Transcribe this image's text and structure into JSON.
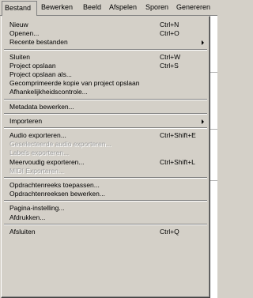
{
  "menubar": {
    "items": [
      "Bestand",
      "Bewerken",
      "Beeld",
      "Afspelen",
      "Sporen",
      "Genereren"
    ]
  },
  "menu": {
    "groups": [
      [
        {
          "label": "Nieuw",
          "shortcut": "Ctrl+N"
        },
        {
          "label": "Openen...",
          "shortcut": "Ctrl+O"
        },
        {
          "label": "Recente bestanden",
          "submenu": true
        }
      ],
      [
        {
          "label": "Sluiten",
          "shortcut": "Ctrl+W"
        },
        {
          "label": "Project opslaan",
          "shortcut": "Ctrl+S"
        },
        {
          "label": "Project opslaan als..."
        },
        {
          "label": "Gecomprimeerde kopie van project opslaan"
        },
        {
          "label": "Afhankelijkheidscontrole..."
        }
      ],
      [
        {
          "label": "Metadata bewerken..."
        }
      ],
      [
        {
          "label": "Importeren",
          "submenu": true
        }
      ],
      [
        {
          "label": "Audio exporteren...",
          "shortcut": "Ctrl+Shift+E"
        },
        {
          "label": "Geselecteerde audio exporteren...",
          "disabled": true
        },
        {
          "label": "Labels exporteren...",
          "disabled": true
        },
        {
          "label": "Meervoudig exporteren...",
          "shortcut": "Ctrl+Shift+L"
        },
        {
          "label": "MIDI Exporteren...",
          "disabled": true
        }
      ],
      [
        {
          "label": "Opdrachtenreeks toepassen..."
        },
        {
          "label": "Opdrachtenreeksen bewerken..."
        }
      ],
      [
        {
          "label": "Pagina-instelling..."
        },
        {
          "label": "Afdrukken..."
        }
      ],
      [
        {
          "label": "Afsluiten",
          "shortcut": "Ctrl+Q"
        }
      ]
    ]
  }
}
